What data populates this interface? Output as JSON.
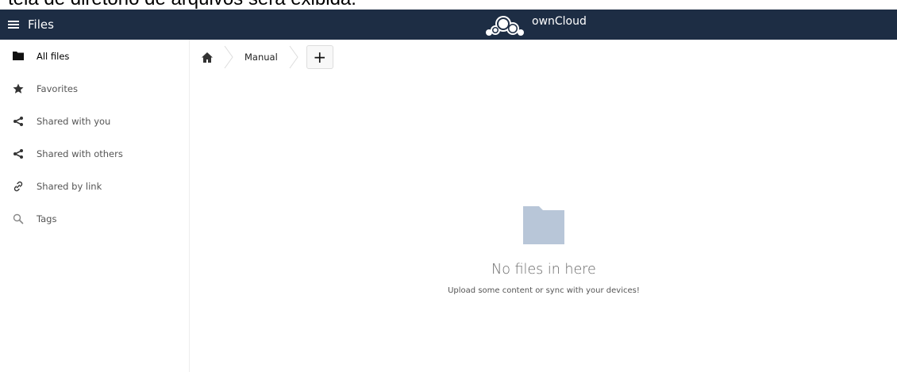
{
  "caption": "tela de diretório de arquivos será exibida.",
  "header": {
    "app_title": "Files",
    "brand_name": "ownCloud"
  },
  "sidebar": {
    "items": [
      {
        "label": "All files",
        "icon": "folder-icon"
      },
      {
        "label": "Favorites",
        "icon": "star-icon"
      },
      {
        "label": "Shared with you",
        "icon": "share-icon"
      },
      {
        "label": "Shared with others",
        "icon": "share-icon"
      },
      {
        "label": "Shared by link",
        "icon": "link-icon"
      },
      {
        "label": "Tags",
        "icon": "search-icon"
      }
    ]
  },
  "breadcrumb": {
    "home_icon": "home-icon",
    "current": "Manual",
    "new_button": "+"
  },
  "empty_state": {
    "icon": "folder-icon",
    "title": "No files in here",
    "subtitle": "Upload some content or sync with your devices!"
  },
  "colors": {
    "header_bg": "#1d2d44",
    "folder": "#b8c6d8"
  }
}
